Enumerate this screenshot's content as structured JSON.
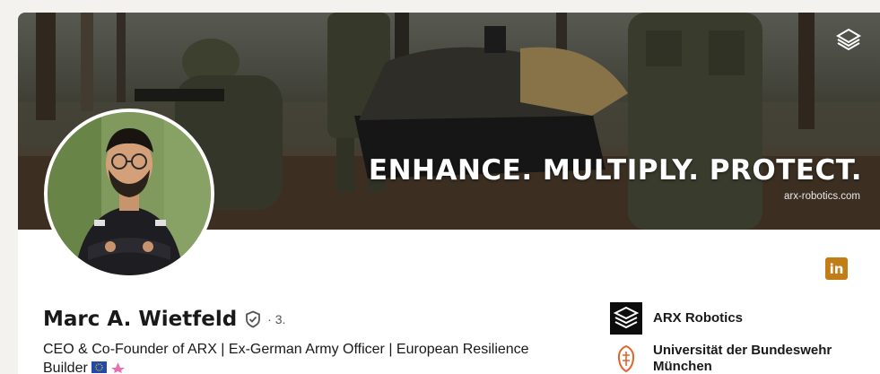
{
  "banner": {
    "tagline": "ENHANCE. MULTIPLY. PROTECT.",
    "website": "arx-robotics.com",
    "logo_icon": "arx-chevron-logo-icon"
  },
  "profile": {
    "name": "Marc A. Wietfeld",
    "degree": "· 3.",
    "headline": "CEO & Co-Founder of ARX | Ex-German Army Officer | European Resilience Builder",
    "verified_icon": "verified-shield-icon",
    "headline_icons": [
      "eu-flag-icon",
      "pink-emblem-icon"
    ]
  },
  "linkedin_badge": {
    "label": "in",
    "color": "#c37d16"
  },
  "organizations": [
    {
      "name": "ARX Robotics",
      "icon": "arx-logo-icon"
    },
    {
      "name": "Universität der Bundeswehr München",
      "icon": "university-emblem-icon"
    }
  ]
}
